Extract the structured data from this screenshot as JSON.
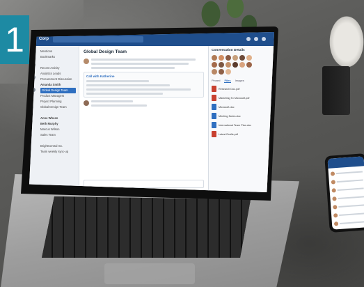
{
  "badge": {
    "number": "1"
  },
  "app": {
    "org_name": "Corp",
    "channel_title": "Global Design Team",
    "details_title": "Conversation Details",
    "sidebar_items": [
      "Mentions",
      "Bookmarks",
      "",
      "Recent Activity",
      "Analytics Leads",
      "Procurement Discussion",
      "Amanda Smith",
      "Global Design Team",
      "Product Managers",
      "Project Planning",
      "Global Design Team",
      "",
      "Anne Wheen",
      "Beth Murphy",
      "Marcus Wilson",
      "Sales Team",
      "",
      "BrightCentral Inc.",
      "Team weekly sync-up"
    ],
    "tabs": [
      "Pinned",
      "Files",
      "Images"
    ],
    "files": [
      "Research Doc.pdf",
      "Marketing To Microsoft.pdf",
      "Microsoft.doc",
      "Meeting Notes.doc",
      "International Team Plan.doc",
      "Latest Drafts.pdf"
    ],
    "file_colors": [
      "#c8402f",
      "#c8402f",
      "#2f6fc0",
      "#2f6fc0",
      "#2f6fc0",
      "#c8402f"
    ],
    "card_title": "Call with Katherine"
  }
}
